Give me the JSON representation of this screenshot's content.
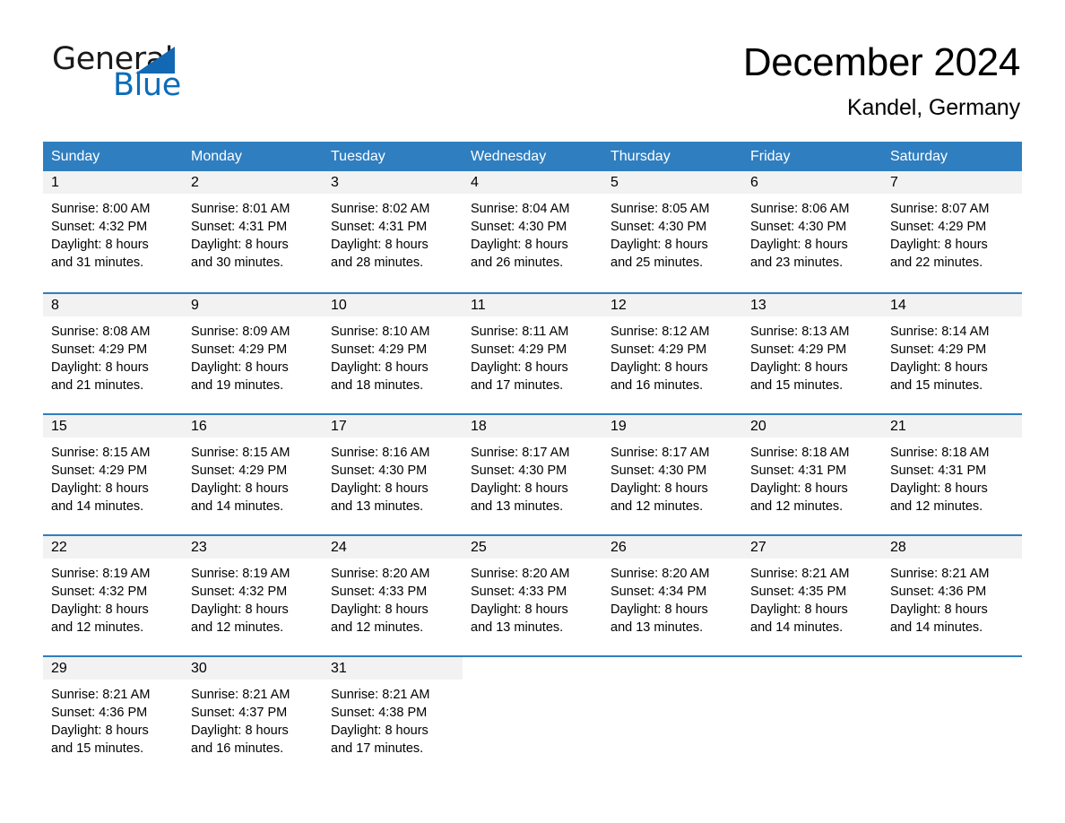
{
  "logo": {
    "word_one": "General",
    "word_two": "Blue",
    "triangle": "triangle-shape"
  },
  "header": {
    "month_title": "December 2024",
    "location": "Kandel, Germany"
  },
  "calendar": {
    "weekdays": [
      "Sunday",
      "Monday",
      "Tuesday",
      "Wednesday",
      "Thursday",
      "Friday",
      "Saturday"
    ],
    "colors": {
      "header_blue": "#2f7ec0",
      "day_band_gray": "#f2f2f2",
      "logo_blue": "#1268b3",
      "text_black": "#000000"
    },
    "weeks": [
      [
        {
          "day": "1",
          "sunrise": "Sunrise: 8:00 AM",
          "sunset": "Sunset: 4:32 PM",
          "daylight_line1": "Daylight: 8 hours",
          "daylight_line2": "and 31 minutes."
        },
        {
          "day": "2",
          "sunrise": "Sunrise: 8:01 AM",
          "sunset": "Sunset: 4:31 PM",
          "daylight_line1": "Daylight: 8 hours",
          "daylight_line2": "and 30 minutes."
        },
        {
          "day": "3",
          "sunrise": "Sunrise: 8:02 AM",
          "sunset": "Sunset: 4:31 PM",
          "daylight_line1": "Daylight: 8 hours",
          "daylight_line2": "and 28 minutes."
        },
        {
          "day": "4",
          "sunrise": "Sunrise: 8:04 AM",
          "sunset": "Sunset: 4:30 PM",
          "daylight_line1": "Daylight: 8 hours",
          "daylight_line2": "and 26 minutes."
        },
        {
          "day": "5",
          "sunrise": "Sunrise: 8:05 AM",
          "sunset": "Sunset: 4:30 PM",
          "daylight_line1": "Daylight: 8 hours",
          "daylight_line2": "and 25 minutes."
        },
        {
          "day": "6",
          "sunrise": "Sunrise: 8:06 AM",
          "sunset": "Sunset: 4:30 PM",
          "daylight_line1": "Daylight: 8 hours",
          "daylight_line2": "and 23 minutes."
        },
        {
          "day": "7",
          "sunrise": "Sunrise: 8:07 AM",
          "sunset": "Sunset: 4:29 PM",
          "daylight_line1": "Daylight: 8 hours",
          "daylight_line2": "and 22 minutes."
        }
      ],
      [
        {
          "day": "8",
          "sunrise": "Sunrise: 8:08 AM",
          "sunset": "Sunset: 4:29 PM",
          "daylight_line1": "Daylight: 8 hours",
          "daylight_line2": "and 21 minutes."
        },
        {
          "day": "9",
          "sunrise": "Sunrise: 8:09 AM",
          "sunset": "Sunset: 4:29 PM",
          "daylight_line1": "Daylight: 8 hours",
          "daylight_line2": "and 19 minutes."
        },
        {
          "day": "10",
          "sunrise": "Sunrise: 8:10 AM",
          "sunset": "Sunset: 4:29 PM",
          "daylight_line1": "Daylight: 8 hours",
          "daylight_line2": "and 18 minutes."
        },
        {
          "day": "11",
          "sunrise": "Sunrise: 8:11 AM",
          "sunset": "Sunset: 4:29 PM",
          "daylight_line1": "Daylight: 8 hours",
          "daylight_line2": "and 17 minutes."
        },
        {
          "day": "12",
          "sunrise": "Sunrise: 8:12 AM",
          "sunset": "Sunset: 4:29 PM",
          "daylight_line1": "Daylight: 8 hours",
          "daylight_line2": "and 16 minutes."
        },
        {
          "day": "13",
          "sunrise": "Sunrise: 8:13 AM",
          "sunset": "Sunset: 4:29 PM",
          "daylight_line1": "Daylight: 8 hours",
          "daylight_line2": "and 15 minutes."
        },
        {
          "day": "14",
          "sunrise": "Sunrise: 8:14 AM",
          "sunset": "Sunset: 4:29 PM",
          "daylight_line1": "Daylight: 8 hours",
          "daylight_line2": "and 15 minutes."
        }
      ],
      [
        {
          "day": "15",
          "sunrise": "Sunrise: 8:15 AM",
          "sunset": "Sunset: 4:29 PM",
          "daylight_line1": "Daylight: 8 hours",
          "daylight_line2": "and 14 minutes."
        },
        {
          "day": "16",
          "sunrise": "Sunrise: 8:15 AM",
          "sunset": "Sunset: 4:29 PM",
          "daylight_line1": "Daylight: 8 hours",
          "daylight_line2": "and 14 minutes."
        },
        {
          "day": "17",
          "sunrise": "Sunrise: 8:16 AM",
          "sunset": "Sunset: 4:30 PM",
          "daylight_line1": "Daylight: 8 hours",
          "daylight_line2": "and 13 minutes."
        },
        {
          "day": "18",
          "sunrise": "Sunrise: 8:17 AM",
          "sunset": "Sunset: 4:30 PM",
          "daylight_line1": "Daylight: 8 hours",
          "daylight_line2": "and 13 minutes."
        },
        {
          "day": "19",
          "sunrise": "Sunrise: 8:17 AM",
          "sunset": "Sunset: 4:30 PM",
          "daylight_line1": "Daylight: 8 hours",
          "daylight_line2": "and 12 minutes."
        },
        {
          "day": "20",
          "sunrise": "Sunrise: 8:18 AM",
          "sunset": "Sunset: 4:31 PM",
          "daylight_line1": "Daylight: 8 hours",
          "daylight_line2": "and 12 minutes."
        },
        {
          "day": "21",
          "sunrise": "Sunrise: 8:18 AM",
          "sunset": "Sunset: 4:31 PM",
          "daylight_line1": "Daylight: 8 hours",
          "daylight_line2": "and 12 minutes."
        }
      ],
      [
        {
          "day": "22",
          "sunrise": "Sunrise: 8:19 AM",
          "sunset": "Sunset: 4:32 PM",
          "daylight_line1": "Daylight: 8 hours",
          "daylight_line2": "and 12 minutes."
        },
        {
          "day": "23",
          "sunrise": "Sunrise: 8:19 AM",
          "sunset": "Sunset: 4:32 PM",
          "daylight_line1": "Daylight: 8 hours",
          "daylight_line2": "and 12 minutes."
        },
        {
          "day": "24",
          "sunrise": "Sunrise: 8:20 AM",
          "sunset": "Sunset: 4:33 PM",
          "daylight_line1": "Daylight: 8 hours",
          "daylight_line2": "and 12 minutes."
        },
        {
          "day": "25",
          "sunrise": "Sunrise: 8:20 AM",
          "sunset": "Sunset: 4:33 PM",
          "daylight_line1": "Daylight: 8 hours",
          "daylight_line2": "and 13 minutes."
        },
        {
          "day": "26",
          "sunrise": "Sunrise: 8:20 AM",
          "sunset": "Sunset: 4:34 PM",
          "daylight_line1": "Daylight: 8 hours",
          "daylight_line2": "and 13 minutes."
        },
        {
          "day": "27",
          "sunrise": "Sunrise: 8:21 AM",
          "sunset": "Sunset: 4:35 PM",
          "daylight_line1": "Daylight: 8 hours",
          "daylight_line2": "and 14 minutes."
        },
        {
          "day": "28",
          "sunrise": "Sunrise: 8:21 AM",
          "sunset": "Sunset: 4:36 PM",
          "daylight_line1": "Daylight: 8 hours",
          "daylight_line2": "and 14 minutes."
        }
      ],
      [
        {
          "day": "29",
          "sunrise": "Sunrise: 8:21 AM",
          "sunset": "Sunset: 4:36 PM",
          "daylight_line1": "Daylight: 8 hours",
          "daylight_line2": "and 15 minutes."
        },
        {
          "day": "30",
          "sunrise": "Sunrise: 8:21 AM",
          "sunset": "Sunset: 4:37 PM",
          "daylight_line1": "Daylight: 8 hours",
          "daylight_line2": "and 16 minutes."
        },
        {
          "day": "31",
          "sunrise": "Sunrise: 8:21 AM",
          "sunset": "Sunset: 4:38 PM",
          "daylight_line1": "Daylight: 8 hours",
          "daylight_line2": "and 17 minutes."
        },
        {
          "day": "",
          "sunrise": "",
          "sunset": "",
          "daylight_line1": "",
          "daylight_line2": ""
        },
        {
          "day": "",
          "sunrise": "",
          "sunset": "",
          "daylight_line1": "",
          "daylight_line2": ""
        },
        {
          "day": "",
          "sunrise": "",
          "sunset": "",
          "daylight_line1": "",
          "daylight_line2": ""
        },
        {
          "day": "",
          "sunrise": "",
          "sunset": "",
          "daylight_line1": "",
          "daylight_line2": ""
        }
      ]
    ]
  }
}
